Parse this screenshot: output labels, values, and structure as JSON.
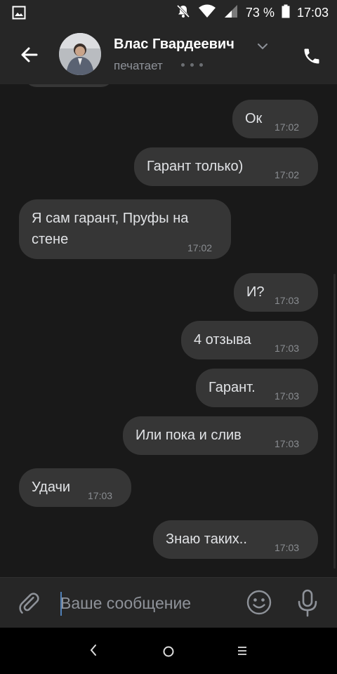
{
  "status_bar": {
    "battery_percent": "73 %",
    "time": "17:03"
  },
  "header": {
    "contact_name": "Влас Гвардеевич",
    "status": "печатает"
  },
  "messages": [
    {
      "direction": "out",
      "text": "Ок",
      "time": "17:02"
    },
    {
      "direction": "out",
      "text": "Гарант только)",
      "time": "17:02"
    },
    {
      "direction": "in",
      "text_line1": "Я сам гарант, Пруфы на",
      "text_line2": "стене",
      "time": "17:02"
    },
    {
      "direction": "out",
      "text": "И?",
      "time": "17:03"
    },
    {
      "direction": "out",
      "text": "4 отзыва",
      "time": "17:03"
    },
    {
      "direction": "out",
      "text": "Гарант.",
      "time": "17:03"
    },
    {
      "direction": "out",
      "text": "Или пока и слив",
      "time": "17:03"
    },
    {
      "direction": "in",
      "text": "Удачи",
      "time": "17:03"
    },
    {
      "direction": "out",
      "text": "Знаю таких..",
      "time": "17:03"
    }
  ],
  "composer": {
    "placeholder": "Ваше сообщение"
  },
  "icons": {
    "back": "arrow-left-icon",
    "call": "phone-icon",
    "attach": "paperclip-icon",
    "emoji": "smiley-icon",
    "mic": "microphone-icon"
  },
  "colors": {
    "background": "#191919",
    "bar": "#262626",
    "bubble": "#363636",
    "accent": "#5181b8"
  }
}
